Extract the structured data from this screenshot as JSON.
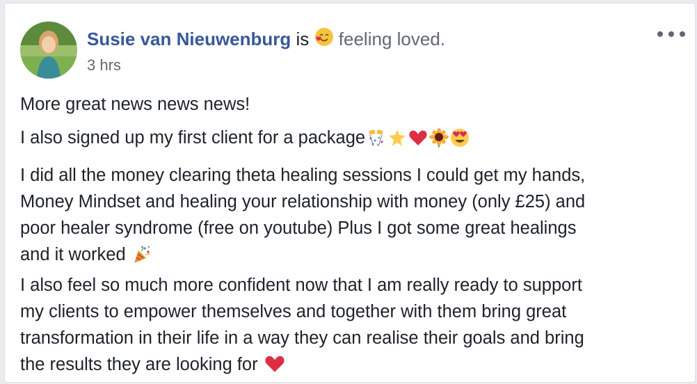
{
  "post": {
    "author": "Susie van Nieuwenburg",
    "is_text": "is",
    "feeling_text": "feeling loved.",
    "timestamp": "3 hrs",
    "lines": [
      "More great news news news!",
      "I also signed up my first client for a package",
      "I did all the money clearing theta healing sessions I could get my hands,",
      "Money Mindset and healing your relationship with money (only £25) and",
      "poor healer syndrome (free on youtube) Plus I got some great healings",
      "and it worked",
      "I also feel so much more confident now that I am really ready to support",
      "my clients to empower themselves and together with them bring great",
      "transformation in their life in a way they can realise their goals and bring",
      "the results they are looking for"
    ]
  },
  "icons": {
    "feeling": "smiling-hearts-emoji-icon",
    "more": "more-options-icon",
    "package_emojis": [
      "confetti-icon",
      "star-icon",
      "red-heart-icon",
      "sunflower-icon",
      "heart-eyes-emoji-icon"
    ],
    "worked_emoji": "party-popper-icon",
    "end_emoji": "red-heart-icon"
  },
  "colors": {
    "author": "#365899",
    "text": "#1d2129",
    "meta": "#616770",
    "heart": "#e0245e"
  }
}
